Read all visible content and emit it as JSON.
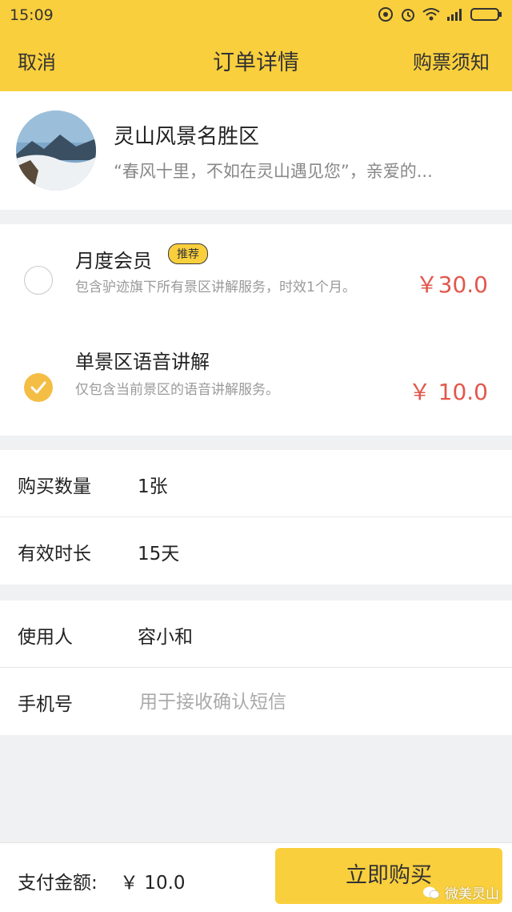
{
  "status_bar": {
    "time": "15:09"
  },
  "nav": {
    "left": "取消",
    "title": "订单详情",
    "right": "购票须知"
  },
  "scenic": {
    "name": "灵山风景名胜区",
    "desc": "“春风十里，不如在灵山遇见您”，亲爱的..."
  },
  "plans": [
    {
      "title": "月度会员",
      "badge": "推荐",
      "desc": "包含驴迹旗下所有景区讲解服务，时效1个月。",
      "price": "￥30.0",
      "selected": false
    },
    {
      "title": "单景区语音讲解",
      "badge": "",
      "desc": "仅包含当前景区的语音讲解服务。",
      "price": "￥ 10.0",
      "selected": true
    }
  ],
  "order": {
    "quantity_label": "购买数量",
    "quantity_value": "1张",
    "duration_label": "有效时长",
    "duration_value": "15天"
  },
  "user": {
    "user_label": "使用人",
    "user_value": "容小和",
    "phone_label": "手机号",
    "phone_placeholder": "用于接收确认短信"
  },
  "footer": {
    "pay_label": "支付金额:",
    "pay_amount": "￥ 10.0",
    "buy_label": "立即购买",
    "watermark": "微美灵山"
  },
  "colors": {
    "accent": "#f9cf3d",
    "price": "#e2574c",
    "selected_radio": "#f4be45"
  }
}
